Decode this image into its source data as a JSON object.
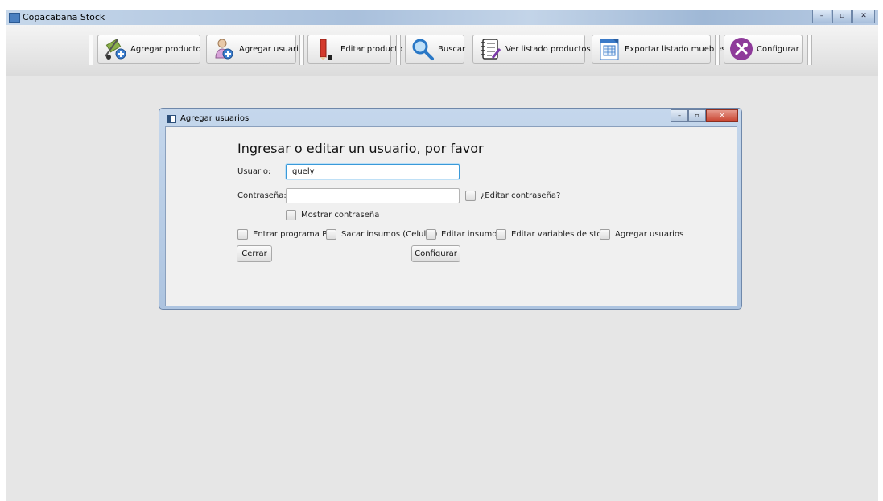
{
  "window": {
    "title": "Copacabana Stock"
  },
  "toolbar": {
    "buttons": [
      {
        "label": "Agregar producto",
        "icon": "hand-truck-add-icon"
      },
      {
        "label": "Agregar usuario",
        "icon": "user-add-icon"
      },
      {
        "label": "Editar producto",
        "icon": "pencil-icon"
      },
      {
        "label": "Buscar",
        "icon": "magnifier-icon"
      },
      {
        "label": "Ver listado productos",
        "icon": "notebook-list-icon"
      },
      {
        "label": "Exportar listado muebles",
        "icon": "spreadsheet-export-icon"
      },
      {
        "label": "Configurar",
        "icon": "tools-icon"
      }
    ]
  },
  "dialog": {
    "title": "Agregar usuarios",
    "heading": "Ingresar o editar un usuario, por favor",
    "user_label": "Usuario:",
    "user_value": "guely",
    "password_label": "Contraseña:",
    "password_value": "",
    "edit_password_label": "¿Editar contraseña?",
    "show_password_label": "Mostrar contraseña",
    "permissions": [
      "Entrar programa PC",
      "Sacar insumos (Celular)",
      "Editar insumos",
      "Editar variables de stock",
      "Agregar usuarios"
    ],
    "close_button": "Cerrar",
    "configure_button": "Configurar"
  }
}
